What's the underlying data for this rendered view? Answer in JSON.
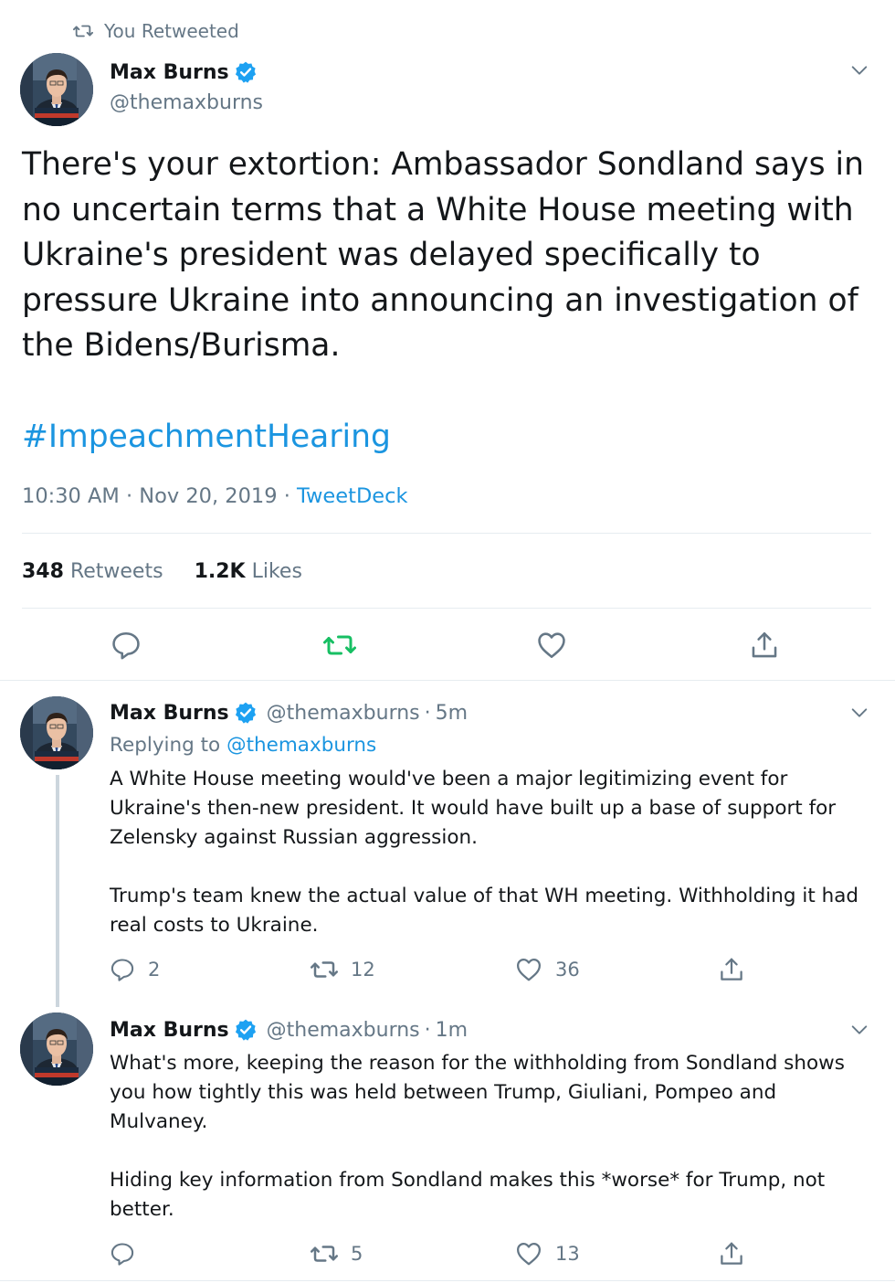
{
  "main_tweet": {
    "retweet_label": "You Retweeted",
    "author_name": "Max Burns",
    "author_handle": "@themaxburns",
    "text": "There's your extortion: Ambassador Sondland says in no uncertain terms that a White House meeting with Ukraine's president was delayed specifically to pressure Ukraine into announcing an investigation of the Bidens/Burisma.",
    "hashtag": "#ImpeachmentHearing",
    "time": "10:30 AM",
    "separator": "·",
    "date": "Nov 20, 2019",
    "source": "TweetDeck",
    "retweets_count": "348",
    "retweets_label": "Retweets",
    "likes_count": "1.2K",
    "likes_label": "Likes"
  },
  "replies": [
    {
      "author_name": "Max Burns",
      "author_handle": "@themaxburns",
      "separator": "·",
      "time": "5m",
      "replying_label": "Replying to",
      "replying_handle": "@themaxburns",
      "paragraphs": [
        "A White House meeting would've been a major legitimizing event for Ukraine's then-new president. It would have built up a base of support for Zelensky against Russian aggression.",
        "Trump's team knew the actual value of that WH meeting. Withholding it had real costs to Ukraine."
      ],
      "reply_count": "2",
      "retweet_count": "12",
      "like_count": "36"
    },
    {
      "author_name": "Max Burns",
      "author_handle": "@themaxburns",
      "separator": "·",
      "time": "1m",
      "paragraphs": [
        "What's more, keeping the reason for the withholding from Sondland shows you how tightly this was held between Trump, Giuliani, Pompeo and Mulvaney.",
        "Hiding key information from Sondland makes this *worse* for Trump, not better."
      ],
      "retweet_count": "5",
      "like_count": "13"
    }
  ],
  "icons": {
    "retweet": "retweet-icon",
    "verified": "verified-badge-icon",
    "caret": "chevron-down-icon",
    "reply": "reply-icon",
    "like": "heart-icon",
    "share": "share-icon"
  },
  "colors": {
    "text": "#14171a",
    "muted": "#657786",
    "link": "#1b95e0",
    "retweet_active": "#17bf63",
    "divider": "#e6ecf0"
  }
}
